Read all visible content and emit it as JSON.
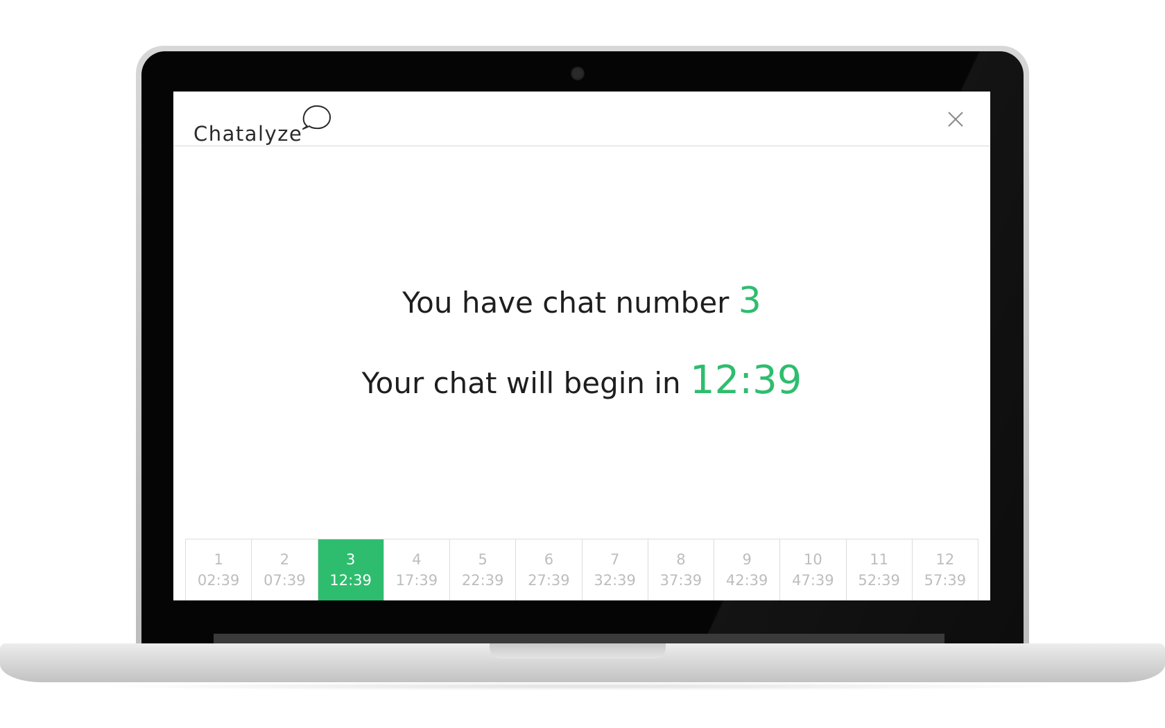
{
  "app": {
    "logo_text": "Chatalyze"
  },
  "queue": {
    "line1_prefix": "You have chat number",
    "chat_number": "3",
    "line2_prefix": "Your chat will begin in",
    "countdown": "12:39"
  },
  "slots": [
    {
      "number": "1",
      "time": "02:39"
    },
    {
      "number": "2",
      "time": "07:39"
    },
    {
      "number": "3",
      "time": "12:39"
    },
    {
      "number": "4",
      "time": "17:39"
    },
    {
      "number": "5",
      "time": "22:39"
    },
    {
      "number": "6",
      "time": "27:39"
    },
    {
      "number": "7",
      "time": "32:39"
    },
    {
      "number": "8",
      "time": "37:39"
    },
    {
      "number": "9",
      "time": "42:39"
    },
    {
      "number": "10",
      "time": "47:39"
    },
    {
      "number": "11",
      "time": "52:39"
    },
    {
      "number": "12",
      "time": "57:39"
    }
  ],
  "active_slot": "3",
  "colors": {
    "accent": "#2ebd6e",
    "muted_text": "#bdbdbd",
    "body_text": "#1e1e1e"
  },
  "icons": {
    "logo": "chat-bubble-icon",
    "close": "close-icon"
  }
}
